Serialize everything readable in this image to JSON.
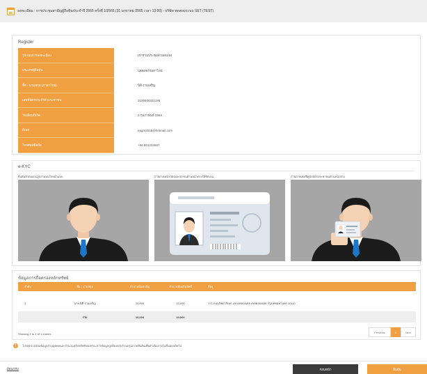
{
  "header": {
    "icon": "calendar-icon",
    "title": "ลงทะเบียน : การประชุมสามัญผู้ถือหุ้นประจำปี 2565 ครั้งที่ 1/2565 (31 มกราคม 2565 เวลา 13:00) - บริษัท ทดสอบระบบ SET (TEST)"
  },
  "register": {
    "title": "Register",
    "rows": [
      {
        "label": "รูปแบบการลงทะเบียน",
        "value": "เข้าร่วมประชุมด้วยตนเอง"
      },
      {
        "label": "ประเภทผู้ถือหุ้น",
        "value": "บุคคลธรรมดาไทย"
      },
      {
        "label": "ชื่อ - นามสกุล (ภาษาไทย)",
        "value": "นิติ งามเจริญ"
      },
      {
        "label": "เลขที่บัตรประจำตัวประชาชน",
        "value": "3100600321196"
      },
      {
        "label": "วันเดือนปีเกิด",
        "value": "2 กุมภาพันธ์ 2564"
      },
      {
        "label": "อีเมล",
        "value": "eagm2018@hotmail.com"
      },
      {
        "label": "โทรศัพท์มือถือ",
        "value": "+66 801234697"
      }
    ]
  },
  "ekyc": {
    "title": "e-KYC",
    "captions": [
      "ยืนยันตัวตนผ่านรูปถ่ายบนใบหน้าแบบ",
      "ถ่ายภาพหน้าบัตรประชาชนด้านหน้าตรงให้ชัดเจน",
      "ถ่ายภาพเซลฟี่คู่กับบัตรประชาชนด้านหน้าตรง"
    ]
  },
  "stock": {
    "title": "ข้อมูลการถือครองหลักทรัพย์",
    "headers": [
      "ลำดับ",
      "ชื่อ - นามสกุล",
      "จำนวนหุ้นสามัญ",
      "จำนวนหุ้นบุริมสิทธิ์",
      "ที่อยู่"
    ],
    "rows": [
      {
        "no": "1",
        "name": "นาย นิติ งามเจริญ",
        "common": "10,000",
        "preferred": "10,000",
        "address": "171 ถนนรัชดาภิเษก แขวงคลองเตย เขตคลองเตย กรุงเทพมหานคร 10110"
      }
    ],
    "total": {
      "label": "รวม",
      "common": "10,000",
      "preferred": "10,000"
    },
    "entries": "Showing 1 to 1 of 1 entries",
    "pager": {
      "prev": "Previous",
      "current": "1",
      "next": "Next"
    }
  },
  "note": {
    "icon": "info-icon",
    "text": "โปรดตรวจสอบข้อมูลส่วนบุคคลและจำนวนหลักทรัพย์ของท่าน หากข้อมูลถูกต้องครบถ้วนกรุณากดยืนยันเพื่อดำเนินการในขั้นตอนถัดไป"
  },
  "footer": {
    "back": "ย้อนกลับ",
    "prev_button": "ก่อนหน้า",
    "confirm_button": "ยืนยัน"
  },
  "colors": {
    "accent": "#f0a040",
    "dark": "#3b3b3b",
    "photo_bg": "#a6a6a6"
  }
}
